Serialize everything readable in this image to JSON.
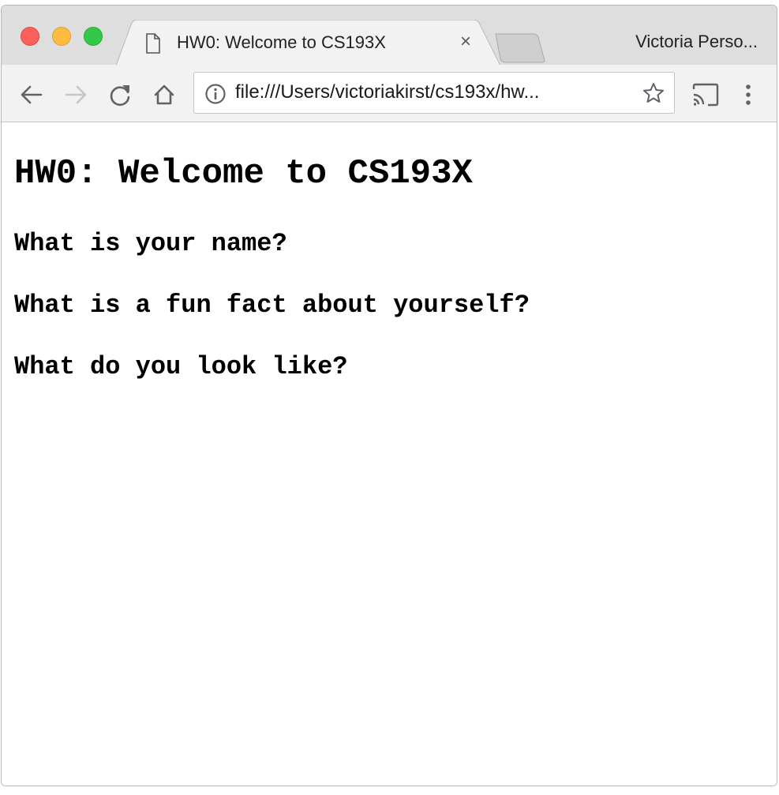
{
  "browser": {
    "tab_title": "HW0: Welcome to CS193X",
    "tab_close": "×",
    "profile_name": "Victoria Perso...",
    "url": "file:///Users/victoriakirst/cs193x/hw..."
  },
  "page": {
    "title": "HW0: Welcome to CS193X",
    "questions": [
      "What is your name?",
      "What is a fun fact about yourself?",
      "What do you look like?"
    ]
  },
  "colors": {
    "traffic_close": "#fc605c",
    "traffic_minimize": "#fdbc40",
    "traffic_maximize": "#34c84a",
    "titlebar": "#dedede",
    "toolbar": "#f2f2f2"
  }
}
